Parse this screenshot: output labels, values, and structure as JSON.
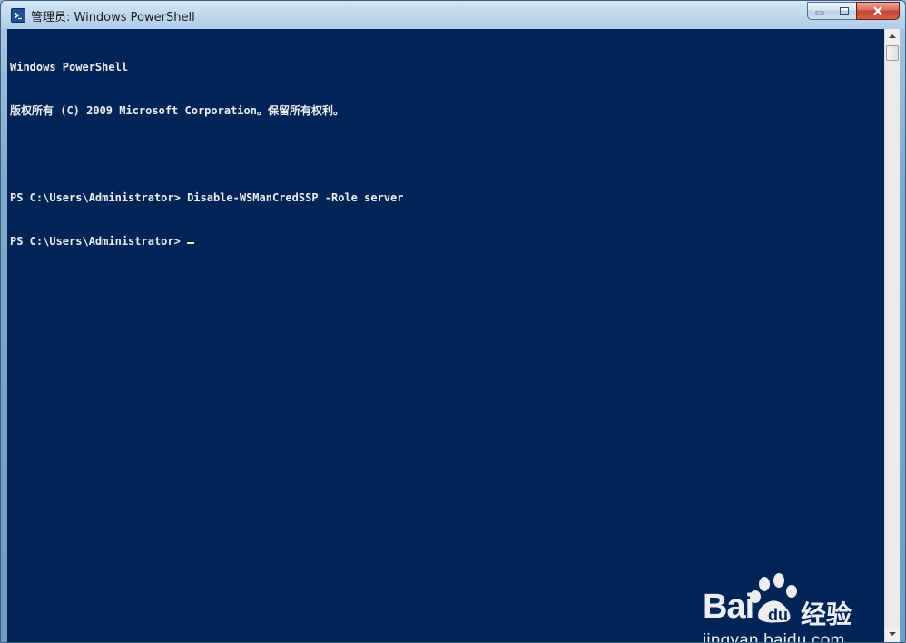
{
  "window": {
    "title": "管理员: Windows PowerShell",
    "icon": "powershell-icon",
    "caption_buttons": [
      "minimize-icon",
      "maximize-icon",
      "close-icon"
    ]
  },
  "console": {
    "background": "#012456",
    "foreground": "#eeedf0",
    "lines": [
      "Windows PowerShell",
      "版权所有 (C) 2009 Microsoft Corporation。保留所有权利。",
      "",
      "PS C:\\Users\\Administrator> Disable-WSManCredSSP -Role server",
      "PS C:\\Users\\Administrator> "
    ]
  },
  "watermark": {
    "brand": "Bai",
    "brand_suffix_icon": "baidu-paw-icon",
    "product": "经验",
    "url": "jingyan.baidu.com"
  }
}
